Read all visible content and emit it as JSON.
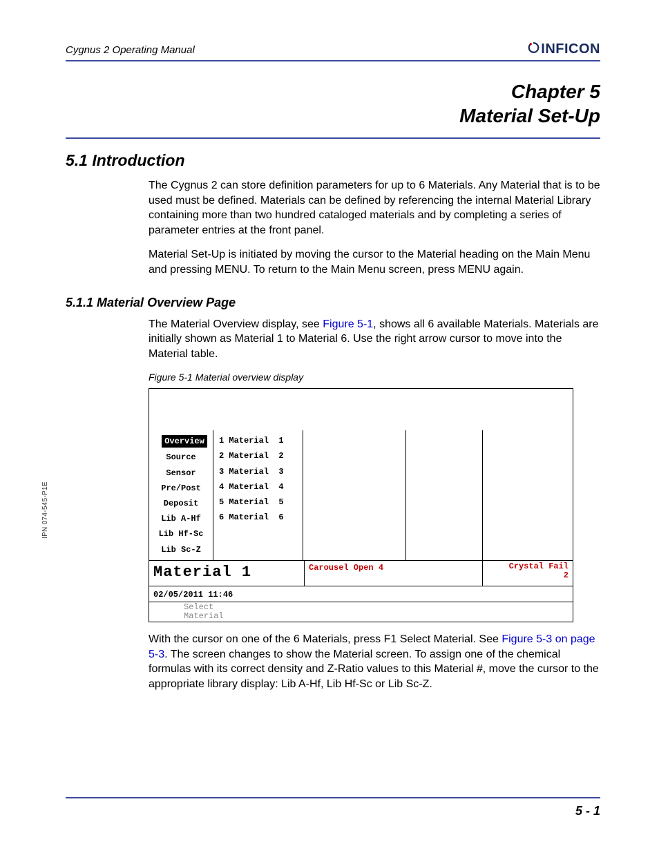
{
  "header": {
    "doc_title": "Cygnus 2 Operating Manual",
    "brand": "INFICON"
  },
  "chapter": {
    "line1": "Chapter 5",
    "line2": "Material Set-Up"
  },
  "section": {
    "num_title": "5.1  Introduction",
    "para1": "The Cygnus 2 can store definition parameters for up to 6 Materials. Any Material that is to be used must be defined. Materials can be defined by referencing the internal Material Library containing more than two hundred cataloged materials and by completing a series of parameter entries at the front panel.",
    "para2": "Material Set-Up is initiated by moving the cursor to the Material heading on the Main Menu and pressing MENU. To return to the Main Menu screen, press MENU again."
  },
  "subsection": {
    "num_title": "5.1.1  Material Overview Page",
    "para1a": "The Material Overview display, see ",
    "para1_link": "Figure 5-1",
    "para1b": ", shows all 6 available Materials. Materials are initially shown as Material 1 to Material 6. Use the right arrow cursor to move into the Material table.",
    "fig_caption": "Figure 5-1  Material overview display",
    "para2a": "With the cursor on one of the 6 Materials, press F1 Select Material. See ",
    "para2_link": "Figure 5-3 on page 5-3",
    "para2b": ". The screen changes to show the Material screen. To assign one of the chemical formulas with its correct density and Z-Ratio values to this Material #, move the cursor to the appropriate library display: Lib A-Hf, Lib Hf-Sc or Lib Sc-Z."
  },
  "screenshot": {
    "menu": [
      "Overview",
      "Source",
      "Sensor",
      "Pre/Post",
      "Deposit",
      "Lib A-Hf",
      "Lib Hf-Sc",
      "Lib Sc-Z"
    ],
    "materials": [
      "1 Material  1",
      "2 Material  2",
      "3 Material  3",
      "4 Material  4",
      "5 Material  5",
      "6 Material  6"
    ],
    "selected_label": "Material  1",
    "status_center": "Carousel Open 4",
    "status_right_l1": "Crystal Fail",
    "status_right_l2": "2",
    "datetime": "02/05/2011   11:46",
    "footer_l1": "Select",
    "footer_l2": "Material"
  },
  "footer": {
    "page_num": "5 - 1",
    "side_label": "IPN 074-545-P1E"
  }
}
